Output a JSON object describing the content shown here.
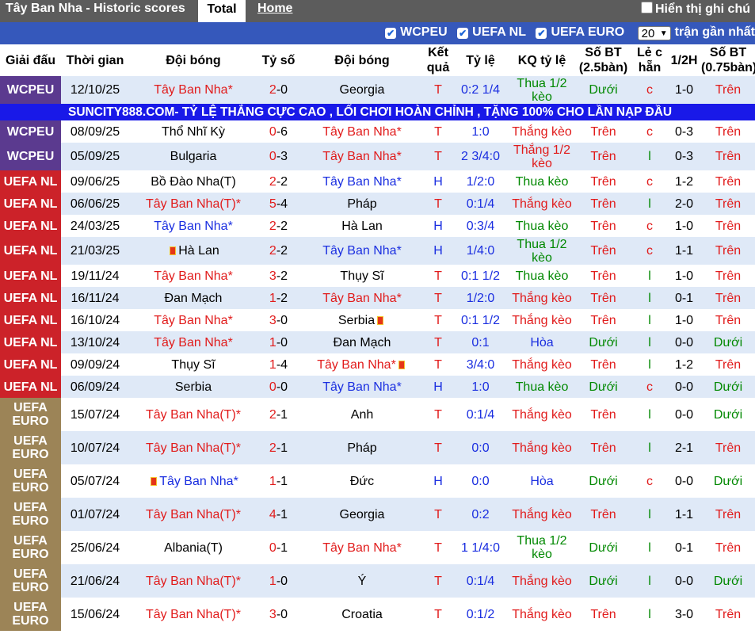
{
  "header": {
    "title": "Tây Ban Nha - Historic scores",
    "tab_total": "Total",
    "tab_home": "Home",
    "show_note": "Hiển thị ghi chú"
  },
  "filters": {
    "wcpeu": "WCPEU",
    "uefanl": "UEFA NL",
    "uefaeuro": "UEFA EURO",
    "count": "20",
    "recent": "trận gần nhất"
  },
  "columns": {
    "league": "Giải đấu",
    "time": "Thời gian",
    "team": "Đội bóng",
    "score": "Tỷ số",
    "team2": "Đội bóng",
    "result": "Kết quả",
    "odds": "Tỷ lệ",
    "odds_result": "KQ tỷ lệ",
    "goals": "Số BT (2.5bàn)",
    "oddeven": "Lẻ c hẵn",
    "half": "1/2H",
    "goals75": "Số BT (0.75bàn)"
  },
  "ad": "SUNCITY888.COM- TỶ LỆ THẮNG CỰC CAO , LỐI CHƠI HOÀN CHỈNH , TẶNG 100% CHO LẦN NẠP ĐẦU",
  "colors": {
    "wcpeu": "#5b3a8f",
    "uefa_nl": "#cc2229",
    "uefa_euro": "#9c8457",
    "win": "#e11b1b",
    "draw": "#1a2ee0",
    "under": "#008800",
    "ad_bg": "#1919e8"
  },
  "matches": [
    {
      "league": "WCPEU",
      "date": "12/10/25",
      "home": "Tây Ban Nha*",
      "score": "2-0",
      "away": "Georgia",
      "result": "T",
      "odds": "0:2 1/4",
      "odds_result": "Thua 1/2 kèo",
      "goals": "Dưới",
      "oe": "c",
      "half": "1-0",
      "goals75": "Trên"
    },
    {
      "league": "WCPEU",
      "date": "08/09/25",
      "home": "Thổ Nhĩ Kỳ",
      "score": "0-6",
      "away": "Tây Ban Nha*",
      "result": "T",
      "odds": "1:0",
      "odds_result": "Thắng kèo",
      "goals": "Trên",
      "oe": "c",
      "half": "0-3",
      "goals75": "Trên"
    },
    {
      "league": "WCPEU",
      "date": "05/09/25",
      "home": "Bulgaria",
      "score": "0-3",
      "away": "Tây Ban Nha*",
      "result": "T",
      "odds": "2 3/4:0",
      "odds_result": "Thắng 1/2 kèo",
      "goals": "Trên",
      "oe": "l",
      "half": "0-3",
      "goals75": "Trên"
    },
    {
      "league": "UEFA NL",
      "date": "09/06/25",
      "home": "Bồ Đào Nha(T)",
      "score": "2-2",
      "away": "Tây Ban Nha*",
      "result": "H",
      "odds": "1/2:0",
      "odds_result": "Thua kèo",
      "goals": "Trên",
      "oe": "c",
      "half": "1-2",
      "goals75": "Trên"
    },
    {
      "league": "UEFA NL",
      "date": "06/06/25",
      "home": "Tây Ban Nha(T)*",
      "score": "5-4",
      "away": "Pháp",
      "result": "T",
      "odds": "0:1/4",
      "odds_result": "Thắng kèo",
      "goals": "Trên",
      "oe": "l",
      "half": "2-0",
      "goals75": "Trên"
    },
    {
      "league": "UEFA NL",
      "date": "24/03/25",
      "home": "Tây Ban Nha*",
      "score": "2-2",
      "away": "Hà Lan",
      "result": "H",
      "odds": "0:3/4",
      "odds_result": "Thua kèo",
      "goals": "Trên",
      "oe": "c",
      "half": "1-0",
      "goals75": "Trên"
    },
    {
      "league": "UEFA NL",
      "date": "21/03/25",
      "home": "Hà Lan",
      "score": "2-2",
      "away": "Tây Ban Nha*",
      "result": "H",
      "odds": "1/4:0",
      "odds_result": "Thua 1/2 kèo",
      "goals": "Trên",
      "oe": "c",
      "half": "1-1",
      "goals75": "Trên"
    },
    {
      "league": "UEFA NL",
      "date": "19/11/24",
      "home": "Tây Ban Nha*",
      "score": "3-2",
      "away": "Thụy Sĩ",
      "result": "T",
      "odds": "0:1 1/2",
      "odds_result": "Thua kèo",
      "goals": "Trên",
      "oe": "l",
      "half": "1-0",
      "goals75": "Trên"
    },
    {
      "league": "UEFA NL",
      "date": "16/11/24",
      "home": "Đan Mạch",
      "score": "1-2",
      "away": "Tây Ban Nha*",
      "result": "T",
      "odds": "1/2:0",
      "odds_result": "Thắng kèo",
      "goals": "Trên",
      "oe": "l",
      "half": "0-1",
      "goals75": "Trên"
    },
    {
      "league": "UEFA NL",
      "date": "16/10/24",
      "home": "Tây Ban Nha*",
      "score": "3-0",
      "away": "Serbia",
      "result": "T",
      "odds": "0:1 1/2",
      "odds_result": "Thắng kèo",
      "goals": "Trên",
      "oe": "l",
      "half": "1-0",
      "goals75": "Trên"
    },
    {
      "league": "UEFA NL",
      "date": "13/10/24",
      "home": "Tây Ban Nha*",
      "score": "1-0",
      "away": "Đan Mạch",
      "result": "T",
      "odds": "0:1",
      "odds_result": "Hòa",
      "goals": "Dưới",
      "oe": "l",
      "half": "0-0",
      "goals75": "Dưới"
    },
    {
      "league": "UEFA NL",
      "date": "09/09/24",
      "home": "Thụy Sĩ",
      "score": "1-4",
      "away": "Tây Ban Nha*",
      "result": "T",
      "odds": "3/4:0",
      "odds_result": "Thắng kèo",
      "goals": "Trên",
      "oe": "l",
      "half": "1-2",
      "goals75": "Trên"
    },
    {
      "league": "UEFA NL",
      "date": "06/09/24",
      "home": "Serbia",
      "score": "0-0",
      "away": "Tây Ban Nha*",
      "result": "H",
      "odds": "1:0",
      "odds_result": "Thua kèo",
      "goals": "Dưới",
      "oe": "c",
      "half": "0-0",
      "goals75": "Dưới"
    },
    {
      "league": "UEFA EURO",
      "date": "15/07/24",
      "home": "Tây Ban Nha(T)*",
      "score": "2-1",
      "away": "Anh",
      "result": "T",
      "odds": "0:1/4",
      "odds_result": "Thắng kèo",
      "goals": "Trên",
      "oe": "l",
      "half": "0-0",
      "goals75": "Dưới"
    },
    {
      "league": "UEFA EURO",
      "date": "10/07/24",
      "home": "Tây Ban Nha(T)*",
      "score": "2-1",
      "away": "Pháp",
      "result": "T",
      "odds": "0:0",
      "odds_result": "Thắng kèo",
      "goals": "Trên",
      "oe": "l",
      "half": "2-1",
      "goals75": "Trên"
    },
    {
      "league": "UEFA EURO",
      "date": "05/07/24",
      "home": "Tây Ban Nha*",
      "score": "1-1",
      "away": "Đức",
      "result": "H",
      "odds": "0:0",
      "odds_result": "Hòa",
      "goals": "Dưới",
      "oe": "c",
      "half": "0-0",
      "goals75": "Dưới"
    },
    {
      "league": "UEFA EURO",
      "date": "01/07/24",
      "home": "Tây Ban Nha(T)*",
      "score": "4-1",
      "away": "Georgia",
      "result": "T",
      "odds": "0:2",
      "odds_result": "Thắng kèo",
      "goals": "Trên",
      "oe": "l",
      "half": "1-1",
      "goals75": "Trên"
    },
    {
      "league": "UEFA EURO",
      "date": "25/06/24",
      "home": "Albania(T)",
      "score": "0-1",
      "away": "Tây Ban Nha*",
      "result": "T",
      "odds": "1 1/4:0",
      "odds_result": "Thua 1/2 kèo",
      "goals": "Dưới",
      "oe": "l",
      "half": "0-1",
      "goals75": "Trên"
    },
    {
      "league": "UEFA EURO",
      "date": "21/06/24",
      "home": "Tây Ban Nha(T)*",
      "score": "1-0",
      "away": "Ý",
      "result": "T",
      "odds": "0:1/4",
      "odds_result": "Thắng kèo",
      "goals": "Dưới",
      "oe": "l",
      "half": "0-0",
      "goals75": "Dưới"
    },
    {
      "league": "UEFA EURO",
      "date": "15/06/24",
      "home": "Tây Ban Nha(T)*",
      "score": "3-0",
      "away": "Croatia",
      "result": "T",
      "odds": "0:1/2",
      "odds_result": "Thắng kèo",
      "goals": "Trên",
      "oe": "l",
      "half": "3-0",
      "goals75": "Trên"
    }
  ]
}
